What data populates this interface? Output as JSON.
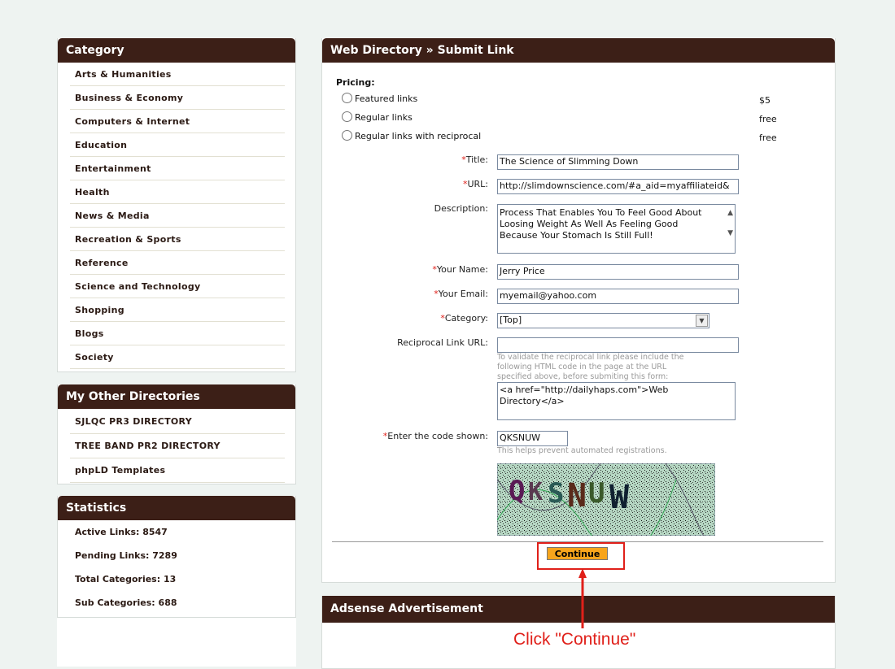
{
  "sidebar": {
    "category": {
      "title": "Category",
      "items": [
        "Arts & Humanities",
        "Business & Economy",
        "Computers & Internet",
        "Education",
        "Entertainment",
        "Health",
        "News & Media",
        "Recreation & Sports",
        "Reference",
        "Science and Technology",
        "Shopping",
        "Blogs",
        "Society"
      ]
    },
    "other": {
      "title": "My Other Directories",
      "items": [
        "SJLQC PR3 DIRECTORY",
        "TREE BAND PR2 DIRECTORY",
        "phpLD Templates"
      ]
    },
    "stats": {
      "title": "Statistics",
      "items": [
        "Active Links: 8547",
        "Pending Links: 7289",
        "Total Categories: 13",
        "Sub Categories: 688"
      ]
    }
  },
  "main": {
    "title": "Web Directory » Submit Link",
    "pricing_label": "Pricing:",
    "pricing": [
      {
        "label": "Featured links",
        "price": "$5"
      },
      {
        "label": "Regular links",
        "price": "free"
      },
      {
        "label": "Regular links with reciprocal",
        "price": "free"
      }
    ],
    "required_mark": "*",
    "labels": {
      "title": "Title:",
      "url": "URL:",
      "description": "Description:",
      "name": "Your Name:",
      "email": "Your Email:",
      "category": "Category:",
      "reciprocal": "Reciprocal Link URL:",
      "code": "Enter the code shown:"
    },
    "values": {
      "title": "The Science of Slimming Down",
      "url": "http://slimdownscience.com/#a_aid=myaffiliateid&",
      "description": "Process That Enables You To Feel Good About Loosing Weight As Well As Feeling Good Because Your Stomach Is Still Full!",
      "name": "Jerry Price",
      "email": "myemail@yahoo.com",
      "category": "[Top]",
      "reciprocal": "",
      "code": "QKSNUW"
    },
    "reciprocal_hint": "To validate the reciprocal link please include the following HTML code in the page at the URL specified above, before submiting this form:",
    "reciprocal_code": "<a href=\"http://dailyhaps.com\">Web Directory</a>",
    "code_hint": "This helps prevent automated registrations.",
    "captcha_text": "QKSNUW",
    "continue_label": "Continue"
  },
  "adsense": {
    "title": "Adsense Advertisement"
  },
  "annotation": {
    "text": "Click \"Continue\"",
    "color": "#e0201a"
  },
  "colors": {
    "header": "#3c1f17",
    "button": "#f7a51c",
    "background": "#eef3f1"
  }
}
